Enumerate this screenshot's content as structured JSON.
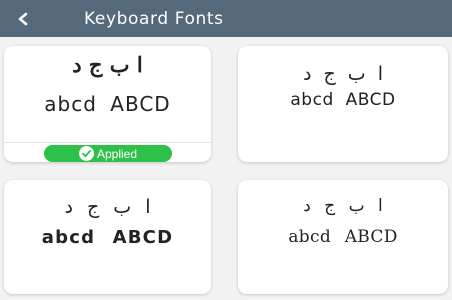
{
  "app_bar": {
    "title": "Keyboard Fonts",
    "back_icon": "back-arrow-icon",
    "background_color": "#54697a"
  },
  "fonts": [
    {
      "urdu_sample": "ا ب ج د",
      "latin_sample": "abcd ABCD",
      "applied": true,
      "badge_label": "Applied",
      "badge_icon": "check-circle-icon",
      "badge_color": "#2ec14a"
    },
    {
      "urdu_sample": "ا ب ج د",
      "latin_sample": "abcd ABCD",
      "applied": false
    },
    {
      "urdu_sample": "ا ب ج د",
      "latin_sample": "abcd ABCD",
      "applied": false
    },
    {
      "urdu_sample": "ا ب ج د",
      "latin_sample": "abcd ABCD",
      "applied": false
    }
  ]
}
